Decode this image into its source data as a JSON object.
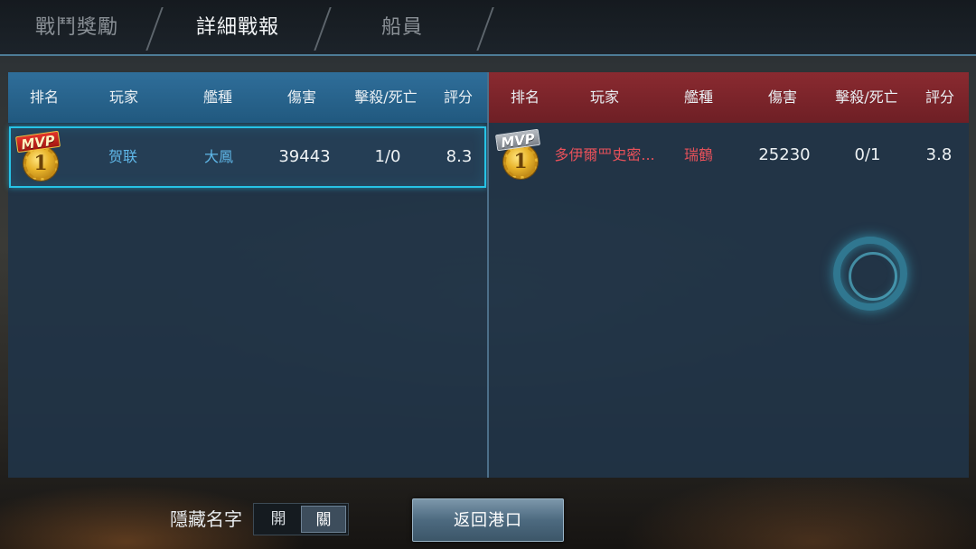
{
  "tabs": [
    {
      "label": "戰鬥獎勵",
      "active": false
    },
    {
      "label": "詳細戰報",
      "active": true
    },
    {
      "label": "船員",
      "active": false
    }
  ],
  "columns": [
    "排名",
    "玩家",
    "艦種",
    "傷害",
    "擊殺/死亡",
    "評分"
  ],
  "left_team": {
    "color": "#21597f",
    "rows": [
      {
        "badge": "MVP",
        "rank": "1",
        "player": "贺联",
        "ship": "大鳳",
        "damage": "39443",
        "kd": "1/0",
        "score": "8.3"
      }
    ]
  },
  "right_team": {
    "color": "#6e1f25",
    "rows": [
      {
        "badge": "MVP",
        "rank": "1",
        "player": "多伊爾罒史密...",
        "ship": "瑞鶴",
        "damage": "25230",
        "kd": "0/1",
        "score": "3.8"
      }
    ]
  },
  "hide_names": {
    "label": "隱藏名字",
    "option_on": "開",
    "option_off": "關",
    "selected": "關"
  },
  "return_button": "返回港口",
  "accent_color": "#27c3e6"
}
